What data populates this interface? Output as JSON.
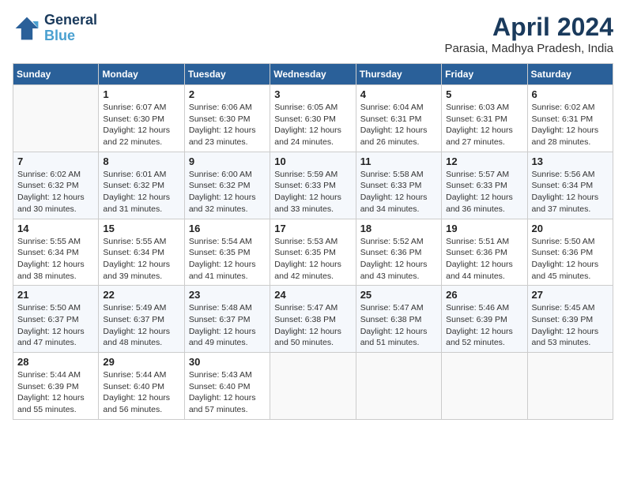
{
  "header": {
    "logo_line1": "General",
    "logo_line2": "Blue",
    "month_year": "April 2024",
    "location": "Parasia, Madhya Pradesh, India"
  },
  "weekdays": [
    "Sunday",
    "Monday",
    "Tuesday",
    "Wednesday",
    "Thursday",
    "Friday",
    "Saturday"
  ],
  "weeks": [
    [
      {
        "day": "",
        "info": ""
      },
      {
        "day": "1",
        "info": "Sunrise: 6:07 AM\nSunset: 6:30 PM\nDaylight: 12 hours\nand 22 minutes."
      },
      {
        "day": "2",
        "info": "Sunrise: 6:06 AM\nSunset: 6:30 PM\nDaylight: 12 hours\nand 23 minutes."
      },
      {
        "day": "3",
        "info": "Sunrise: 6:05 AM\nSunset: 6:30 PM\nDaylight: 12 hours\nand 24 minutes."
      },
      {
        "day": "4",
        "info": "Sunrise: 6:04 AM\nSunset: 6:31 PM\nDaylight: 12 hours\nand 26 minutes."
      },
      {
        "day": "5",
        "info": "Sunrise: 6:03 AM\nSunset: 6:31 PM\nDaylight: 12 hours\nand 27 minutes."
      },
      {
        "day": "6",
        "info": "Sunrise: 6:02 AM\nSunset: 6:31 PM\nDaylight: 12 hours\nand 28 minutes."
      }
    ],
    [
      {
        "day": "7",
        "info": "Sunrise: 6:02 AM\nSunset: 6:32 PM\nDaylight: 12 hours\nand 30 minutes."
      },
      {
        "day": "8",
        "info": "Sunrise: 6:01 AM\nSunset: 6:32 PM\nDaylight: 12 hours\nand 31 minutes."
      },
      {
        "day": "9",
        "info": "Sunrise: 6:00 AM\nSunset: 6:32 PM\nDaylight: 12 hours\nand 32 minutes."
      },
      {
        "day": "10",
        "info": "Sunrise: 5:59 AM\nSunset: 6:33 PM\nDaylight: 12 hours\nand 33 minutes."
      },
      {
        "day": "11",
        "info": "Sunrise: 5:58 AM\nSunset: 6:33 PM\nDaylight: 12 hours\nand 34 minutes."
      },
      {
        "day": "12",
        "info": "Sunrise: 5:57 AM\nSunset: 6:33 PM\nDaylight: 12 hours\nand 36 minutes."
      },
      {
        "day": "13",
        "info": "Sunrise: 5:56 AM\nSunset: 6:34 PM\nDaylight: 12 hours\nand 37 minutes."
      }
    ],
    [
      {
        "day": "14",
        "info": "Sunrise: 5:55 AM\nSunset: 6:34 PM\nDaylight: 12 hours\nand 38 minutes."
      },
      {
        "day": "15",
        "info": "Sunrise: 5:55 AM\nSunset: 6:34 PM\nDaylight: 12 hours\nand 39 minutes."
      },
      {
        "day": "16",
        "info": "Sunrise: 5:54 AM\nSunset: 6:35 PM\nDaylight: 12 hours\nand 41 minutes."
      },
      {
        "day": "17",
        "info": "Sunrise: 5:53 AM\nSunset: 6:35 PM\nDaylight: 12 hours\nand 42 minutes."
      },
      {
        "day": "18",
        "info": "Sunrise: 5:52 AM\nSunset: 6:36 PM\nDaylight: 12 hours\nand 43 minutes."
      },
      {
        "day": "19",
        "info": "Sunrise: 5:51 AM\nSunset: 6:36 PM\nDaylight: 12 hours\nand 44 minutes."
      },
      {
        "day": "20",
        "info": "Sunrise: 5:50 AM\nSunset: 6:36 PM\nDaylight: 12 hours\nand 45 minutes."
      }
    ],
    [
      {
        "day": "21",
        "info": "Sunrise: 5:50 AM\nSunset: 6:37 PM\nDaylight: 12 hours\nand 47 minutes."
      },
      {
        "day": "22",
        "info": "Sunrise: 5:49 AM\nSunset: 6:37 PM\nDaylight: 12 hours\nand 48 minutes."
      },
      {
        "day": "23",
        "info": "Sunrise: 5:48 AM\nSunset: 6:37 PM\nDaylight: 12 hours\nand 49 minutes."
      },
      {
        "day": "24",
        "info": "Sunrise: 5:47 AM\nSunset: 6:38 PM\nDaylight: 12 hours\nand 50 minutes."
      },
      {
        "day": "25",
        "info": "Sunrise: 5:47 AM\nSunset: 6:38 PM\nDaylight: 12 hours\nand 51 minutes."
      },
      {
        "day": "26",
        "info": "Sunrise: 5:46 AM\nSunset: 6:39 PM\nDaylight: 12 hours\nand 52 minutes."
      },
      {
        "day": "27",
        "info": "Sunrise: 5:45 AM\nSunset: 6:39 PM\nDaylight: 12 hours\nand 53 minutes."
      }
    ],
    [
      {
        "day": "28",
        "info": "Sunrise: 5:44 AM\nSunset: 6:39 PM\nDaylight: 12 hours\nand 55 minutes."
      },
      {
        "day": "29",
        "info": "Sunrise: 5:44 AM\nSunset: 6:40 PM\nDaylight: 12 hours\nand 56 minutes."
      },
      {
        "day": "30",
        "info": "Sunrise: 5:43 AM\nSunset: 6:40 PM\nDaylight: 12 hours\nand 57 minutes."
      },
      {
        "day": "",
        "info": ""
      },
      {
        "day": "",
        "info": ""
      },
      {
        "day": "",
        "info": ""
      },
      {
        "day": "",
        "info": ""
      }
    ]
  ]
}
